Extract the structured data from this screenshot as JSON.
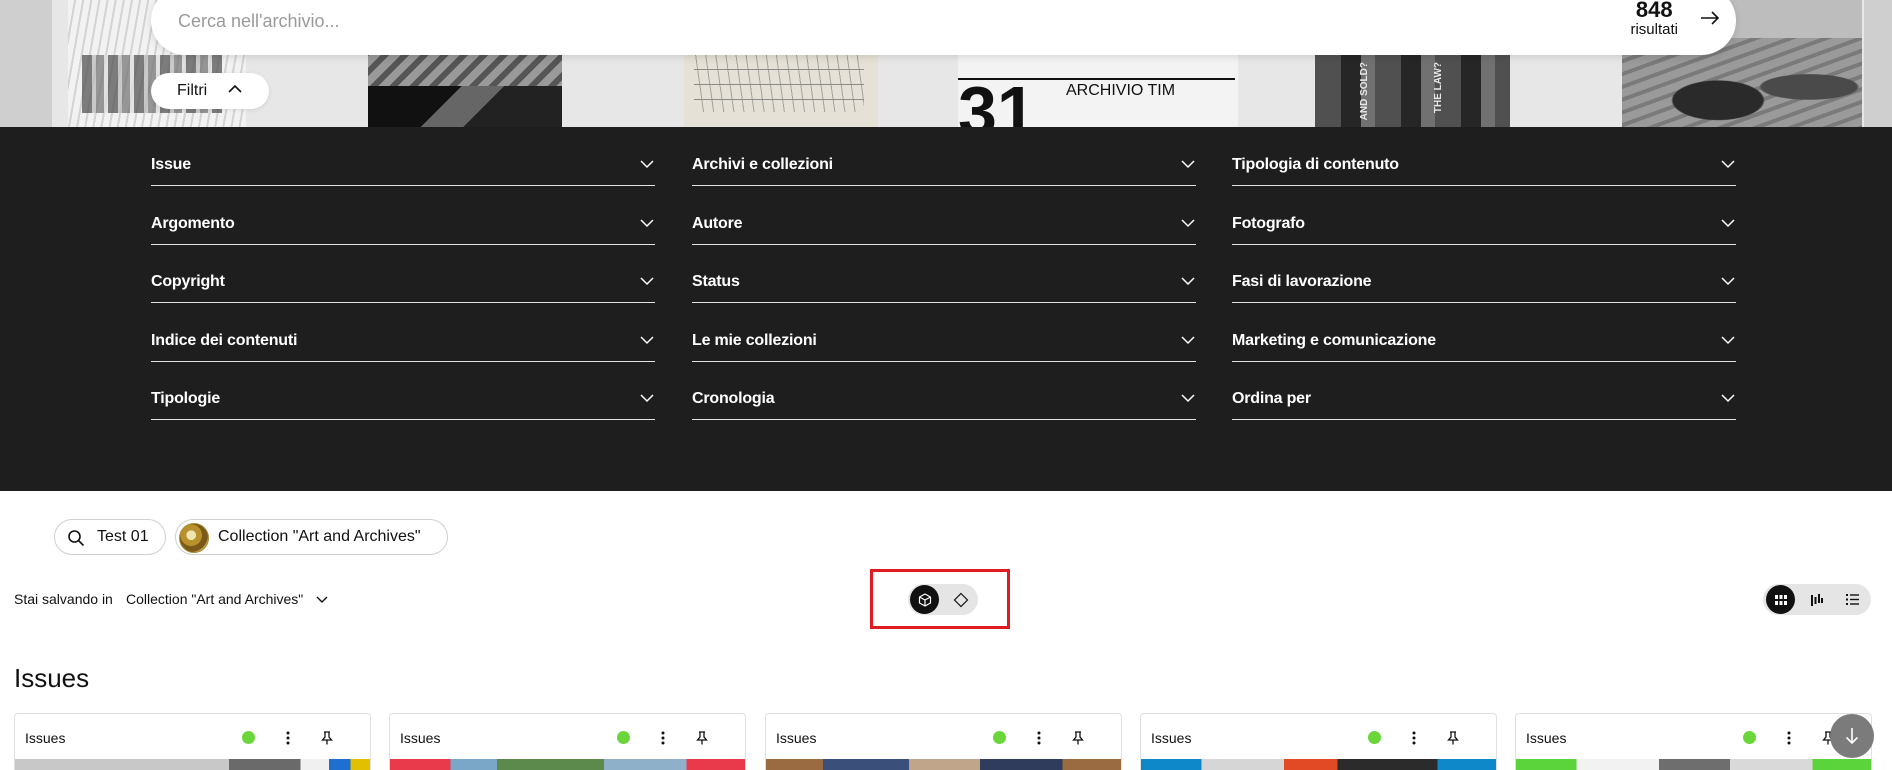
{
  "search": {
    "placeholder": "Cerca nell'archivio...",
    "value": ""
  },
  "results": {
    "count": "848",
    "label": "risultati"
  },
  "filtri_label": "Filtri",
  "hero": {
    "tile_number": "31",
    "tile_label": "ARCHIVIO TIM",
    "book_spines": [
      "AND SOLD?",
      "THE LAW?"
    ]
  },
  "filters": [
    {
      "label": "Issue"
    },
    {
      "label": "Archivi e collezioni"
    },
    {
      "label": "Tipologia di contenuto"
    },
    {
      "label": "Argomento"
    },
    {
      "label": "Autore"
    },
    {
      "label": "Fotografo"
    },
    {
      "label": "Copyright"
    },
    {
      "label": "Status"
    },
    {
      "label": "Fasi di lavorazione"
    },
    {
      "label": "Indice dei contenuti"
    },
    {
      "label": "Le mie collezioni"
    },
    {
      "label": "Marketing e comunicazione"
    },
    {
      "label": "Tipologie"
    },
    {
      "label": "Cronologia"
    },
    {
      "label": "Ordina per"
    }
  ],
  "chips": {
    "search_term": "Test 01",
    "collection": "Collection \"Art and Archives\""
  },
  "saving": {
    "label": "Stai salvando in",
    "value": "Collection \"Art and Archives\""
  },
  "mode_toggle": {
    "active": "cube",
    "options": [
      "cube-icon",
      "diamond-icon"
    ]
  },
  "view_toggle": {
    "active": "grid",
    "options": [
      "grid-icon",
      "bar-chart-icon",
      "list-icon"
    ]
  },
  "section_title": "Issues",
  "cards": [
    {
      "title": "Issues",
      "status_color": "#6bd63a"
    },
    {
      "title": "Issues",
      "status_color": "#6bd63a"
    },
    {
      "title": "Issues",
      "status_color": "#6bd63a"
    },
    {
      "title": "Issues",
      "status_color": "#6bd63a"
    },
    {
      "title": "Issues",
      "status_color": "#6bd63a"
    }
  ],
  "colors": {
    "panel_bg": "#1e1e1e",
    "highlight": "#e11b22",
    "status_green": "#6bd63a"
  }
}
